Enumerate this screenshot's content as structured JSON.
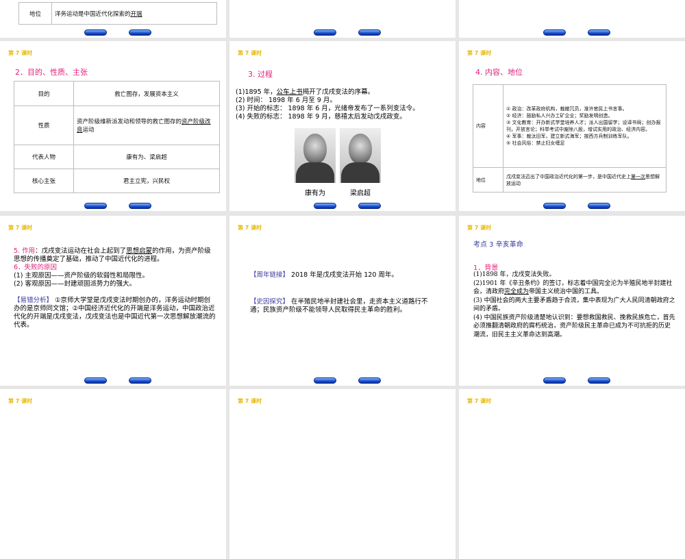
{
  "lesson_label": "第 7 课时",
  "slide_top": {
    "row_label": "地位",
    "row_text_prefix": "洋务运动是中国近代化探索的",
    "row_text_underlined": "开端"
  },
  "slide2": {
    "heading": "2．目的、性质、主张",
    "rows": [
      {
        "label": "目的",
        "text": "救亡图存，发展资本主义"
      },
      {
        "label": "性质",
        "text": "资产阶级维新派发动和领导的救亡图存的",
        "underlined": "资产阶级改良",
        "suffix": "运动"
      },
      {
        "label": "代表人物",
        "text": "康有为、梁启超"
      },
      {
        "label": "核心主张",
        "text": "君主立宪，兴民权"
      }
    ]
  },
  "slide3": {
    "heading": "3. 过程",
    "line1_prefix": "(1)1895 年，",
    "line1_underlined": "公车上书",
    "line1_suffix": "揭开了戊戌变法的序幕。",
    "line2": "(2) 时间： 1898 年 6 月至 9 月。",
    "line3": "(3) 开始的标志： 1898 年 6 月，光绪帝发布了一系列变法令。",
    "line4": "(4) 失败的标志： 1898 年 9 月，慈禧太后发动戊戌政变。",
    "caption1": "康有为",
    "caption2": "梁启超"
  },
  "slide4": {
    "heading": "4. 内容、地位",
    "label1": "内容",
    "items": [
      "① 政治：改革政府机构，裁撤冗员，准许官民上书言事。",
      "② 经济：鼓励私人兴办工矿企业；奖励发明创造。",
      "③ 文化教育：开办新式学堂培养人才；派人出国留学；设译书局；创办报刊，开放言论；科举考试中废除八股，增试实用的政治、经济内容。",
      "④ 军事：裁汰旧军，建立新式海军；按西方兵制训练军队。",
      "⑤ 社会风俗：禁止妇女缠足"
    ],
    "label2": "地位",
    "status_prefix": "戊戌变法迈出了中国政治近代化的第一步，是中国近代史上",
    "status_underlined": "第一次",
    "status_suffix": "思想解放运动"
  },
  "slide5": {
    "h5": "5. 作用",
    "p5_prefix": "：戊戌变法运动在社会上起到了",
    "p5_underlined": "思想启蒙",
    "p5_suffix": "的作用，为资产阶级思想的传播奠定了基础，推动了中国近代化的进程。",
    "h6": "6．失败的原因",
    "r1": "(1) 主观原因——资产阶级的软弱性和局限性。",
    "r2": "(2) 客观原因——封建顽固派势力的强大。",
    "tag": "【易错分析】",
    "analysis": " ①京师大学堂是戊戌变法时期创办的，洋务运动时期创办的是京师同文馆；②中国经济近代化的开端是洋务运动，中国政治近代化的开端是戊戌变法，戊戌变法也是中国近代第一次思想解放潮流的代表。"
  },
  "slide6": {
    "tag1": "【周年链接】",
    "text1": "  2018 年是戊戌变法开始 120 周年。",
    "tag2": "【史因探究】",
    "text2": "  在半殖民地半封建社会里，走资本主义道路行不通；民族资产阶级不能领导人民取得民主革命的胜利。"
  },
  "slide7": {
    "title": "考点 3  辛亥革命",
    "heading": "1．背景",
    "l1": "(1)1898 年，戊戌变法失败。",
    "l2_prefix": "(2)1901 年《辛丑条约》的签订，标志着中国完全沦为半殖民地半封建社会，清政府",
    "l2_underlined": "完全成为",
    "l2_suffix": "帝国主义统治中国的工具。",
    "l3": "(3) 中国社会的两大主要矛盾趋于合流，集中表现为广大人民同清朝政府之间的矛盾。",
    "l4": "(4) 中国民族资产阶级清楚地认识到：要想救国救民、挽救民族危亡，首先必须推翻清朝政府的腐朽统治，资产阶级民主革命已成为不可抗拒的历史潮流，旧民主主义革命达到高潮。"
  }
}
